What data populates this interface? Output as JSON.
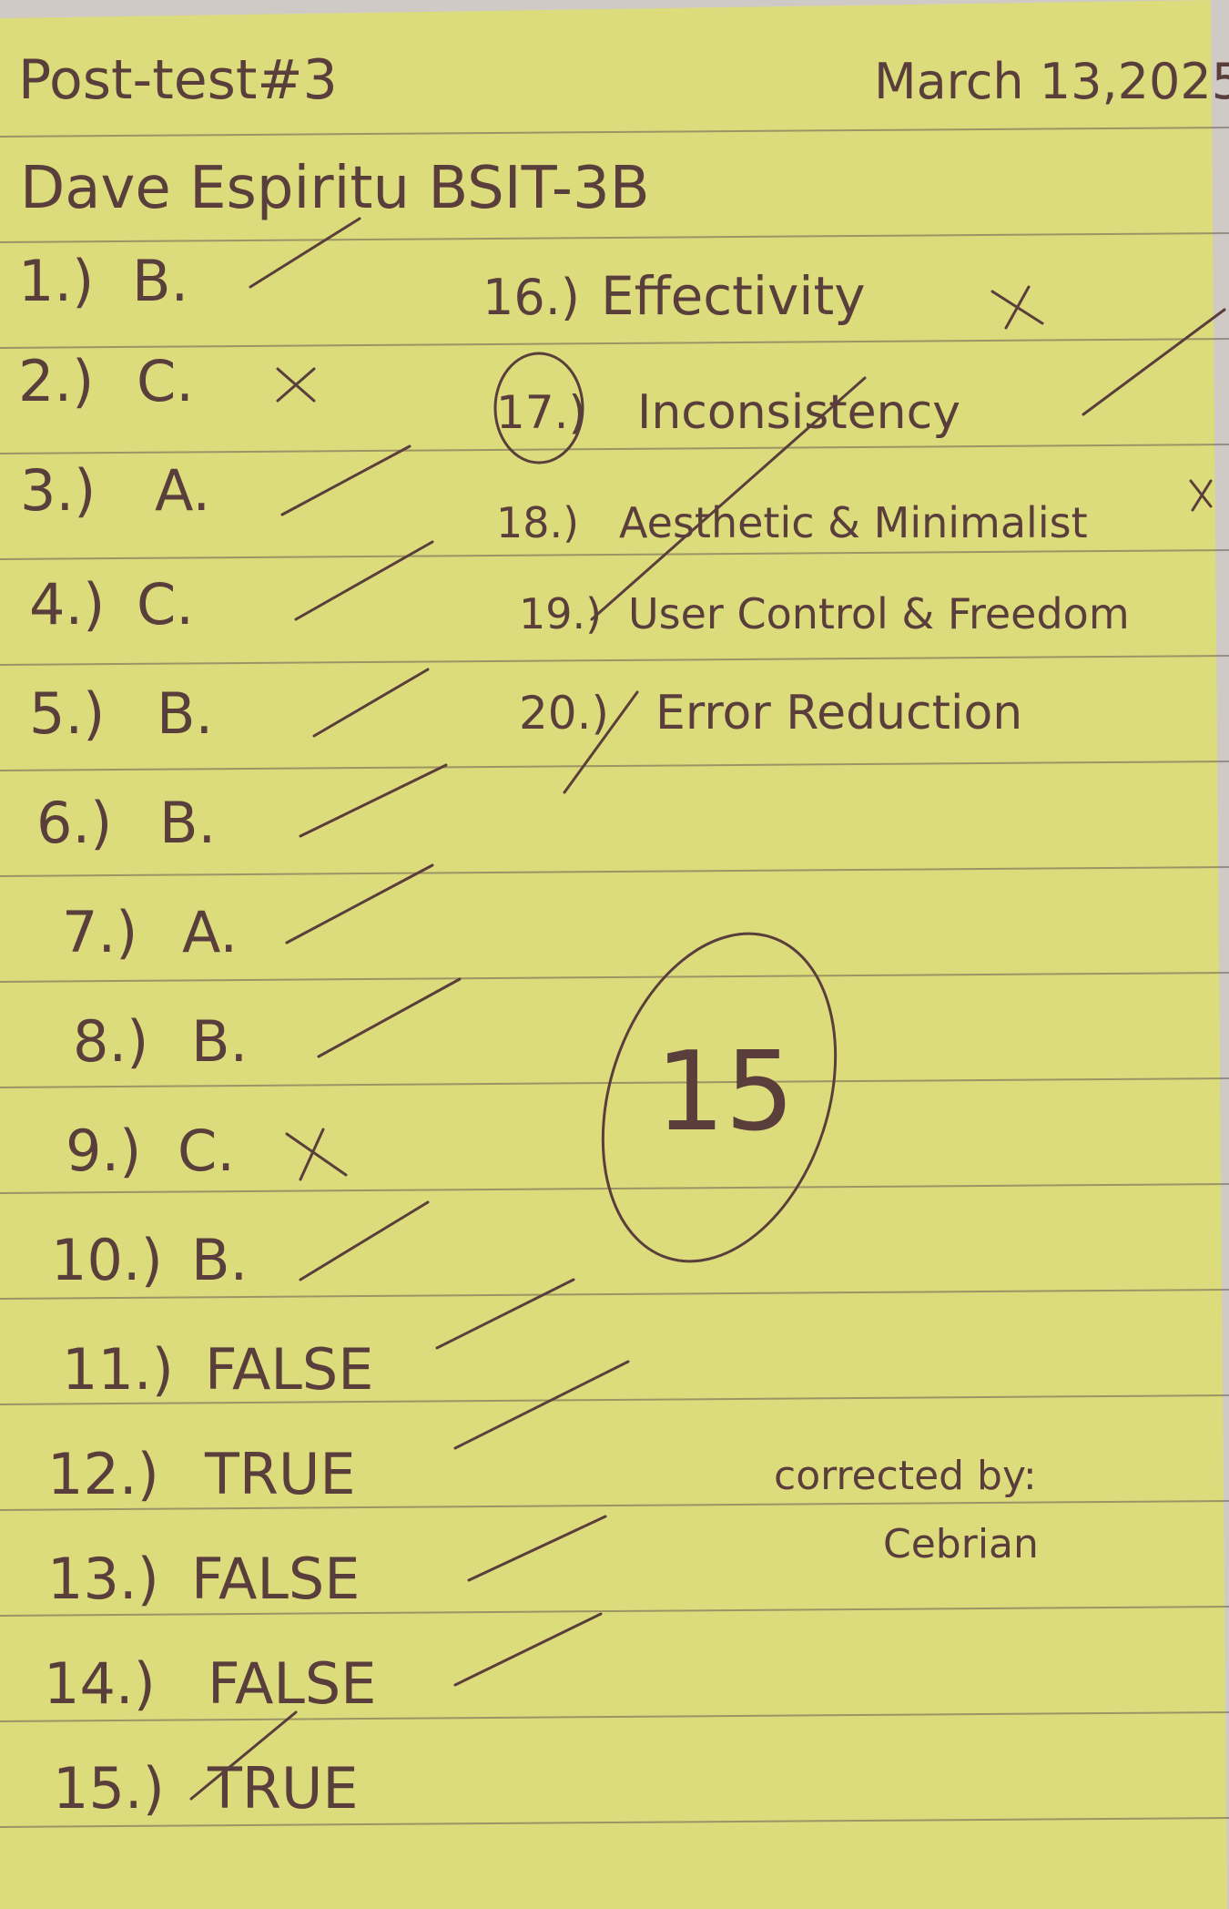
{
  "header": {
    "title": "Post-test#3",
    "date": "March 13,2025"
  },
  "student": {
    "name_line": "Dave Espiritu BSIT-3B"
  },
  "answers": [
    {
      "num": "1.)",
      "answer": "B.",
      "mark": "check"
    },
    {
      "num": "2.)",
      "answer": "C.",
      "mark": "x"
    },
    {
      "num": "3.)",
      "answer": "A.",
      "mark": "check"
    },
    {
      "num": "4.)",
      "answer": "C.",
      "mark": "check"
    },
    {
      "num": "5.)",
      "answer": "B.",
      "mark": "check"
    },
    {
      "num": "6.)",
      "answer": "B.",
      "mark": "check"
    },
    {
      "num": "7.)",
      "answer": "A.",
      "mark": "check"
    },
    {
      "num": "8.)",
      "answer": "B.",
      "mark": "check"
    },
    {
      "num": "9.)",
      "answer": "C.",
      "mark": "x"
    },
    {
      "num": "10.)",
      "answer": "B.",
      "mark": "check"
    },
    {
      "num": "11.)",
      "answer": "FALSE",
      "mark": "check"
    },
    {
      "num": "12.)",
      "answer": "TRUE",
      "mark": "check"
    },
    {
      "num": "13.)",
      "answer": "FALSE",
      "mark": "check"
    },
    {
      "num": "14.)",
      "answer": "FALSE",
      "mark": "check"
    },
    {
      "num": "15.)",
      "answer": "TRUE",
      "mark": "check"
    },
    {
      "num": "16.)",
      "answer": "Effectivity",
      "mark": "x"
    },
    {
      "num": "17.)",
      "answer": "Inconsistency",
      "mark": "x"
    },
    {
      "num": "18.)",
      "answer": "Aesthetic & Minimalist",
      "mark": "x"
    },
    {
      "num": "19.)",
      "answer": "User Control & Freedom",
      "mark": "check"
    },
    {
      "num": "20.)",
      "answer": "Error Reduction",
      "mark": "check"
    }
  ],
  "score": "15",
  "corrected_by": {
    "label": "corrected by:",
    "name": "Cebrian"
  },
  "colors": {
    "paper": "#dcdc7c",
    "ink": "#5a3e3c",
    "rule_line": "#6b5a55"
  }
}
